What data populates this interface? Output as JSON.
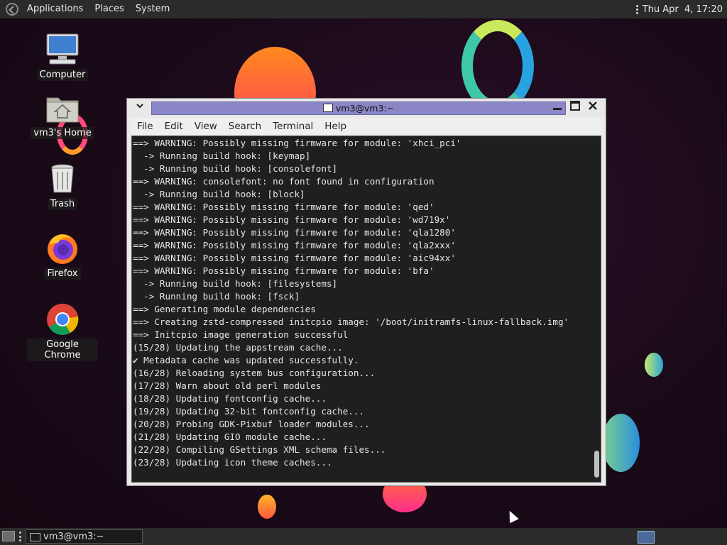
{
  "top_panel": {
    "menus": [
      "Applications",
      "Places",
      "System"
    ],
    "clock": "Thu Apr  4, 17:20"
  },
  "desktop_icons": [
    {
      "label": "Computer",
      "icon": "computer-icon"
    },
    {
      "label": "vm3's Home",
      "icon": "home-folder-icon"
    },
    {
      "label": "Trash",
      "icon": "trash-icon"
    },
    {
      "label": "Firefox",
      "icon": "firefox-icon"
    },
    {
      "label": "Google Chrome",
      "icon": "chrome-icon"
    }
  ],
  "terminal": {
    "title": "vm3@vm3:~",
    "menu": [
      "File",
      "Edit",
      "View",
      "Search",
      "Terminal",
      "Help"
    ],
    "lines": [
      "==> WARNING: Possibly missing firmware for module: 'xhci_pci'",
      "  -> Running build hook: [keymap]",
      "  -> Running build hook: [consolefont]",
      "==> WARNING: consolefont: no font found in configuration",
      "  -> Running build hook: [block]",
      "==> WARNING: Possibly missing firmware for module: 'qed'",
      "==> WARNING: Possibly missing firmware for module: 'wd719x'",
      "==> WARNING: Possibly missing firmware for module: 'qla1280'",
      "==> WARNING: Possibly missing firmware for module: 'qla2xxx'",
      "==> WARNING: Possibly missing firmware for module: 'aic94xx'",
      "==> WARNING: Possibly missing firmware for module: 'bfa'",
      "  -> Running build hook: [filesystems]",
      "  -> Running build hook: [fsck]",
      "==> Generating module dependencies",
      "==> Creating zstd-compressed initcpio image: '/boot/initramfs-linux-fallback.img'",
      "==> Initcpio image generation successful",
      "(15/28) Updating the appstream cache...",
      "✔ Metadata cache was updated successfully.",
      "(16/28) Reloading system bus configuration...",
      "(17/28) Warn about old perl modules",
      "(18/28) Updating fontconfig cache...",
      "(19/28) Updating 32-bit fontconfig cache...",
      "(20/28) Probing GDK-Pixbuf loader modules...",
      "(21/28) Updating GIO module cache...",
      "(22/28) Compiling GSettings XML schema files...",
      "(23/28) Updating icon theme caches..."
    ]
  },
  "taskbar": {
    "task_label": "vm3@vm3:~"
  }
}
